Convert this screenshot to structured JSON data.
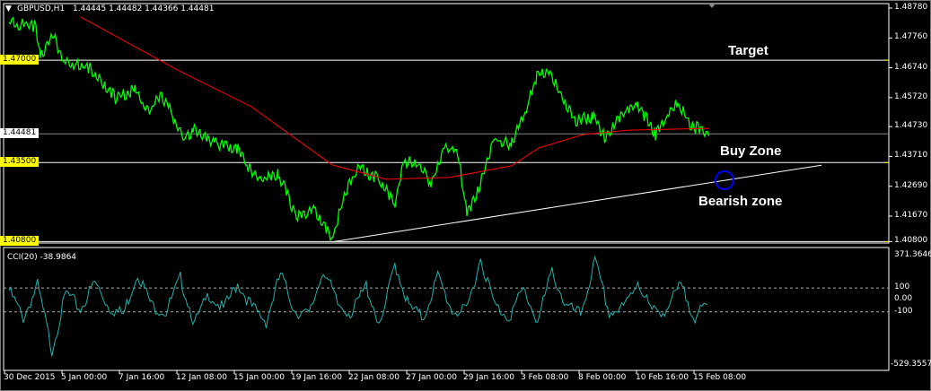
{
  "header": {
    "symbol": "GBPUSD,H1",
    "ohlc": "1.44445 1.44482 1.44366 1.44481"
  },
  "cci_label": "CCI(20) -38.9864",
  "annotations": {
    "target": "Target",
    "buy_zone": "Buy Zone",
    "bearish_zone": "Bearish zone"
  },
  "colors": {
    "price": "#00ff00",
    "ma": "#ff0000",
    "cci": "#20b2aa",
    "level": "#ffff00",
    "trend": "#ffffff",
    "circle": "#0000ff"
  },
  "chart_data": {
    "type": "line",
    "price_axis": {
      "ticks": [
        "1.48780",
        "1.47760",
        "1.46740",
        "1.45720",
        "1.44730",
        "1.43710",
        "1.42690",
        "1.41670",
        "1.40800"
      ],
      "range": [
        1.4078,
        1.4878
      ]
    },
    "levels": [
      {
        "value": 1.47,
        "label": "1.47000"
      },
      {
        "value": 1.435,
        "label": "1.43500"
      },
      {
        "value": 1.408,
        "label": "1.40800"
      }
    ],
    "current_price": {
      "value": 1.44481,
      "label": "1.44481"
    },
    "x_ticks": [
      "30 Dec 2015",
      "5 Jan 00:00",
      "7 Jan 16:00",
      "12 Jan 08:00",
      "15 Jan 00:00",
      "19 Jan 16:00",
      "22 Jan 08:00",
      "27 Jan 00:00",
      "29 Jan 16:00",
      "3 Feb 08:00",
      "8 Feb 00:00",
      "10 Feb 16:00",
      "15 Feb 08:00"
    ],
    "series": [
      {
        "name": "GBPUSD",
        "x": [
          0,
          30,
          35,
          50,
          60,
          90,
          120,
          140,
          155,
          170,
          195,
          205,
          230,
          255,
          265,
          280,
          300,
          320,
          340,
          360,
          375,
          390,
          410,
          430,
          440,
          460,
          470,
          485,
          500,
          510,
          525,
          540,
          560,
          575,
          588,
          600,
          615,
          630,
          650,
          665,
          680,
          700,
          720,
          745,
          760,
          780
        ],
        "values": [
          1.4829,
          1.4814,
          1.4722,
          1.4783,
          1.4691,
          1.4676,
          1.4568,
          1.4599,
          1.4522,
          1.4584,
          1.4431,
          1.4461,
          1.4415,
          1.44,
          1.4339,
          1.4293,
          1.4308,
          1.417,
          1.4185,
          1.4093,
          1.4247,
          1.4339,
          1.4293,
          1.4216,
          1.4354,
          1.4339,
          1.4277,
          1.44,
          1.4385,
          1.417,
          1.4277,
          1.4431,
          1.4415,
          1.4522,
          1.4645,
          1.466,
          1.4584,
          1.4492,
          1.4507,
          1.4431,
          1.4507,
          1.4553,
          1.4446,
          1.4553,
          1.4476,
          1.4448
        ]
      },
      {
        "name": "MA",
        "x": [
          80,
          190,
          270,
          360,
          420,
          490,
          560,
          590,
          640,
          690,
          780
        ],
        "values": [
          1.4847,
          1.4663,
          1.4541,
          1.4342,
          1.4293,
          1.4299,
          1.4339,
          1.44,
          1.4446,
          1.4461,
          1.4467
        ]
      }
    ],
    "trendline": {
      "from": {
        "x": 362,
        "value": 1.408
      },
      "to": {
        "x": 905,
        "value": 1.4341
      }
    },
    "cci": {
      "name": "CCI(20)",
      "range": [
        -529.3557,
        371.3646
      ],
      "ticks": [
        "371.3646",
        "100",
        "0.00",
        "-100",
        "-529.3557"
      ],
      "levels": [
        100,
        -100
      ],
      "values": [
        80,
        -150,
        120,
        -420,
        60,
        -80,
        150,
        -60,
        -120,
        230,
        -50,
        -100,
        180,
        -200,
        50,
        -80,
        140,
        -60,
        -180,
        220,
        -90,
        -130,
        260,
        -40,
        -110,
        120,
        -230,
        310,
        -60,
        -150,
        200,
        -90,
        -100,
        350,
        -50,
        -140,
        90,
        -180,
        240,
        -60,
        -120,
        320,
        -110,
        -70,
        160,
        -100,
        -80,
        120,
        -140,
        -39
      ]
    }
  }
}
